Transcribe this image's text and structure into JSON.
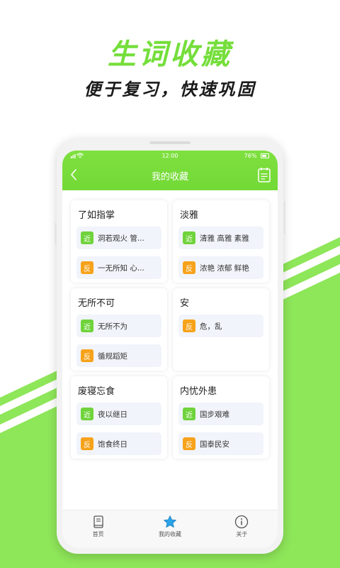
{
  "promo": {
    "title": "生词收藏",
    "subtitle": "便于复习，快速巩固"
  },
  "colors": {
    "brand_green": "#74de3a",
    "near_tag": "#6fd33b",
    "anti_tag": "#f7a21b",
    "tab_active_icon": "#2aa3e8"
  },
  "status_bar": {
    "time": "12:00",
    "battery": "76%"
  },
  "nav": {
    "title": "我的收藏",
    "back_icon": "chevron-left-icon",
    "calendar_icon": "calendar-icon"
  },
  "cards": [
    {
      "word": "了如指掌",
      "relations": [
        {
          "tag": "近",
          "type": "near",
          "text": "洞若观火 管..."
        },
        {
          "tag": "反",
          "type": "anti",
          "text": "一无所知 心..."
        }
      ]
    },
    {
      "word": "淡雅",
      "relations": [
        {
          "tag": "近",
          "type": "near",
          "text": "清雅 高雅 素雅"
        },
        {
          "tag": "反",
          "type": "anti",
          "text": "浓艳 浓郁 鲜艳"
        }
      ]
    },
    {
      "word": "无所不可",
      "relations": [
        {
          "tag": "近",
          "type": "near",
          "text": "无所不为"
        },
        {
          "tag": "反",
          "type": "anti",
          "text": "循规蹈矩"
        }
      ]
    },
    {
      "word": "安",
      "relations": [
        {
          "tag": "反",
          "type": "anti",
          "text": "危，乱"
        }
      ]
    },
    {
      "word": "废寝忘食",
      "relations": [
        {
          "tag": "近",
          "type": "near",
          "text": "夜以继日"
        },
        {
          "tag": "反",
          "type": "anti",
          "text": "饱食终日"
        }
      ]
    },
    {
      "word": "内忧外患",
      "relations": [
        {
          "tag": "近",
          "type": "near",
          "text": "国步艰难"
        },
        {
          "tag": "反",
          "type": "anti",
          "text": "国泰民安"
        }
      ]
    }
  ],
  "tabs": [
    {
      "label": "首页",
      "icon": "book-icon",
      "active": false
    },
    {
      "label": "我的收藏",
      "icon": "star-icon",
      "active": true
    },
    {
      "label": "关于",
      "icon": "info-icon",
      "active": false
    }
  ]
}
